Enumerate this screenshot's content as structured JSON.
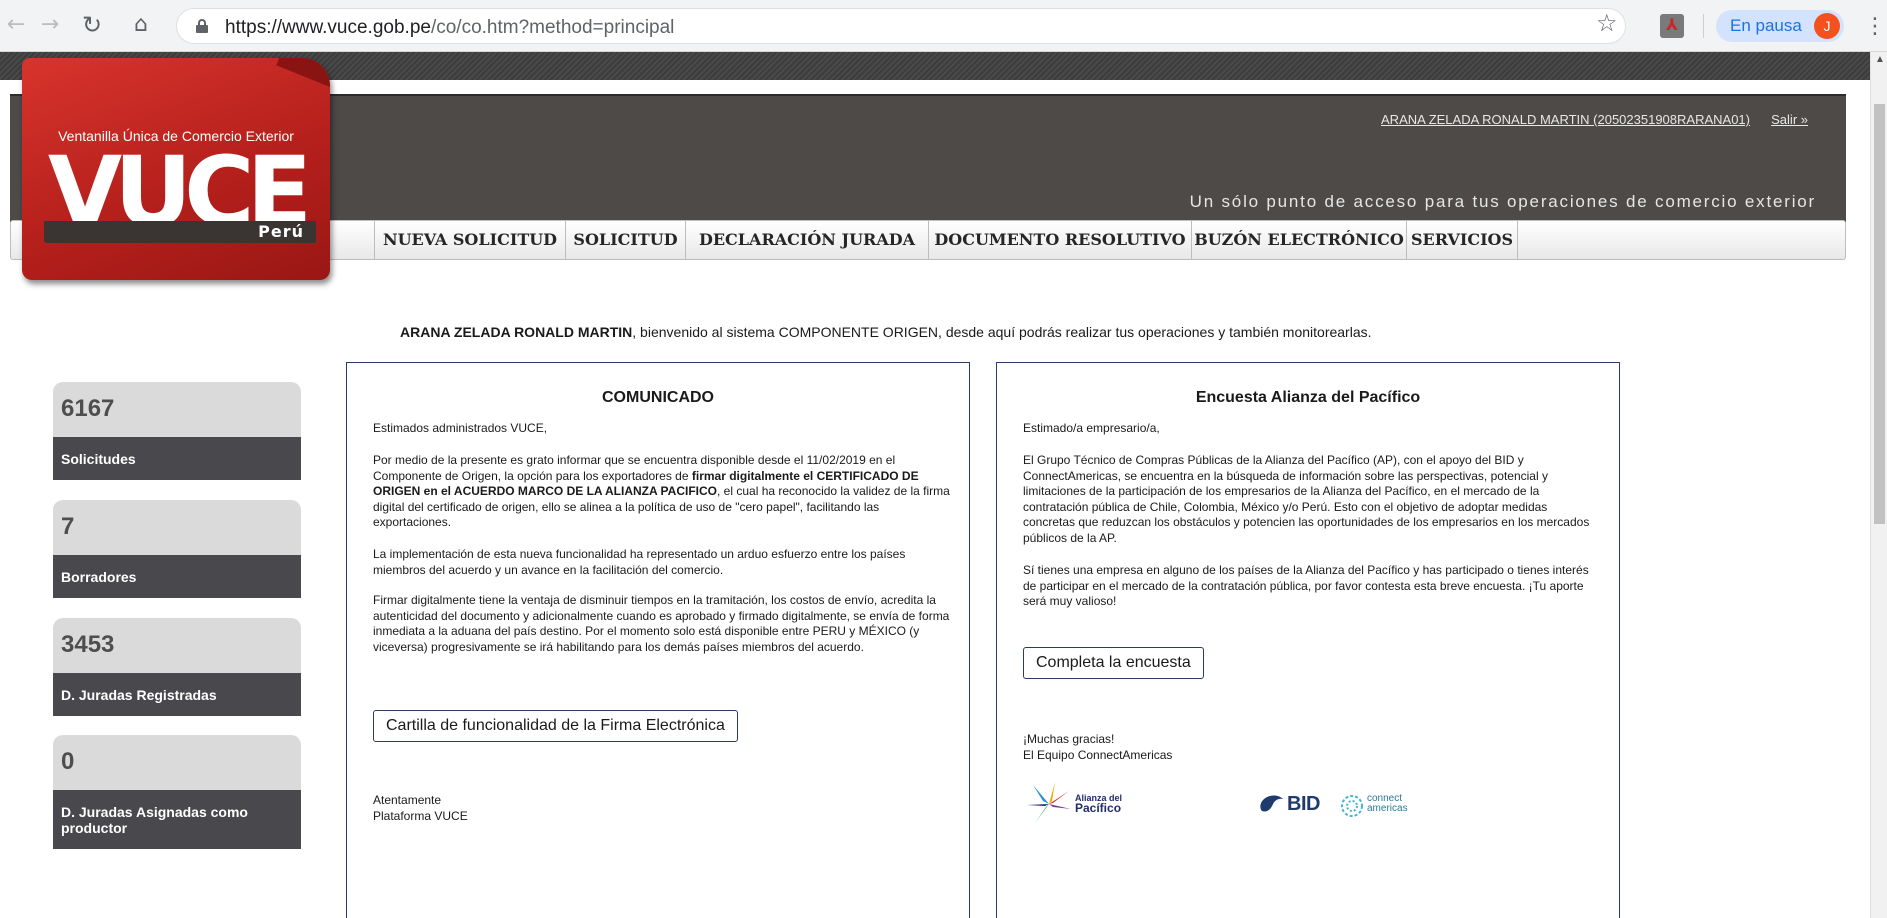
{
  "browser": {
    "url_host": "https://www.vuce.gob.pe",
    "url_path": "/co/co.htm?method=principal",
    "paused_label": "En pausa",
    "profile_initial": "J",
    "icons": [
      "back-icon",
      "forward-icon",
      "reload-icon",
      "home-icon",
      "lock-icon",
      "star-icon",
      "pdf-extension-icon",
      "menu-icon"
    ]
  },
  "header": {
    "user_link": "ARANA ZELADA RONALD MARTIN (20502351908RARANA01)",
    "logout": "Salir »",
    "tagline": "Un sólo punto de acceso para tus operaciones de comercio exterior",
    "logo": {
      "tagline": "Ventanilla Única de Comercio Exterior",
      "wordmark": "VUCE",
      "country": "Perú"
    }
  },
  "menu": [
    "NUEVA SOLICITUD",
    "SOLICITUD",
    "DECLARACIÓN JURADA",
    "DOCUMENTO RESOLUTIVO",
    "BUZÓN ELECTRÓNICO",
    "SERVICIOS"
  ],
  "welcome": {
    "name": "ARANA ZELADA RONALD MARTIN",
    "message": ", bienvenido al sistema COMPONENTE ORIGEN, desde aquí podrás realizar tus operaciones y también monitorearlas."
  },
  "stats": [
    {
      "value": "6167",
      "label": "Solicitudes"
    },
    {
      "value": "7",
      "label": "Borradores"
    },
    {
      "value": "3453",
      "label": "D. Juradas Registradas"
    },
    {
      "value": "0",
      "label": "D. Juradas Asignadas como productor"
    }
  ],
  "comunicado": {
    "title": "COMUNICADO",
    "greeting": "Estimados administrados VUCE,",
    "para1_a": "Por medio de la presente es grato informar que se encuentra disponible desde el 11/02/2019 en el Componente de Origen, la opción para los exportadores de ",
    "para1_b": "firmar digitalmente el CERTIFICADO DE ORIGEN en el ACUERDO MARCO DE LA ALIANZA PACIFICO",
    "para1_c": ", el cual ha reconocido la validez de la firma digital del certificado de origen, ello se alinea a la política de uso de \"cero papel\", facilitando las exportaciones.",
    "para2": "La implementación de esta nueva funcionalidad ha representado un arduo esfuerzo entre los países miembros del acuerdo y un avance en la facilitación del comercio.",
    "para3": "Firmar digitalmente tiene la ventaja de disminuir tiempos en la tramitación, los costos de envío, acredita la autenticidad del documento y adicionalmente cuando es aprobado y firmado digitalmente, se envía de forma inmediata a la aduana del país destino. Por el momento solo está disponible entre PERU y MÉXICO (y viceversa) progresivamente se irá habilitando para los demás países miembros del acuerdo.",
    "button": "Cartilla de funcionalidad de la Firma Electrónica",
    "sign1": "Atentamente",
    "sign2": "Plataforma VUCE"
  },
  "encuesta": {
    "title": "Encuesta Alianza del Pacífico",
    "greeting": "Estimado/a empresario/a,",
    "para1": "El Grupo Técnico de Compras Públicas de la Alianza del Pacífico (AP), con el apoyo del BID y ConnectAmericas, se encuentra en la búsqueda de información sobre las perspectivas, potencial y limitaciones de la participación de los empresarios de la Alianza del Pacífico, en el mercado de la contratación pública de Chile, Colombia, México y/o Perú. Esto con el objetivo de adoptar medidas concretas que reduzcan los obstáculos y potencien las oportunidades de los empresarios en los mercados públicos de la AP.",
    "para2": "Sí tienes una empresa en alguno de los países de la Alianza del Pacífico y has participado o tienes interés de participar en el mercado de la contratación pública, por favor contesta esta breve encuesta. ¡Tu aporte será muy valioso!",
    "button": "Completa la encuesta",
    "thanks1": "¡Muchas gracias!",
    "thanks2": "El Equipo ConnectAmericas",
    "alianza_small": "Alianza del",
    "alianza_big": "Pacífico",
    "bid": "BID",
    "connect_1": "connect",
    "connect_2": "americas"
  },
  "colors": {
    "brand_red": "#c0271f",
    "header_dark": "#4d4a48",
    "panel_border": "#2b3a66"
  }
}
